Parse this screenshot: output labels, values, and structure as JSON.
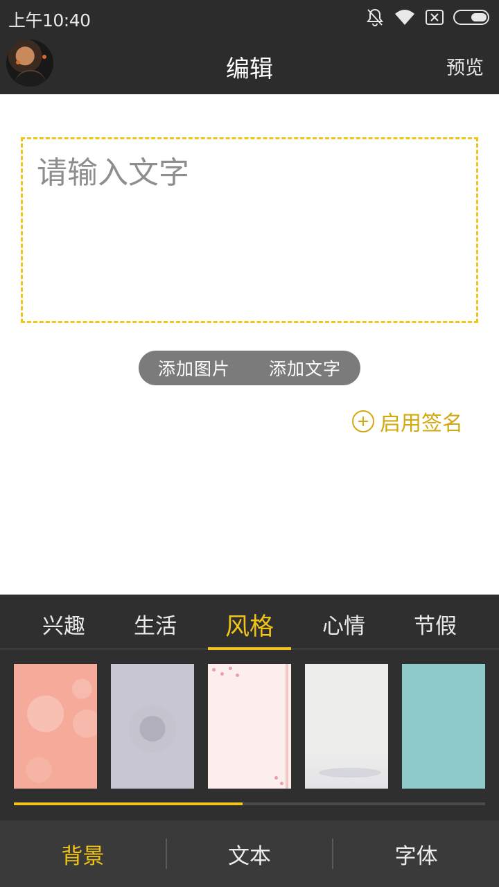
{
  "status_bar": {
    "time": "上午10:40",
    "icons": [
      "notifications-off-icon",
      "wifi-icon",
      "sim-card-none-icon",
      "battery-icon"
    ]
  },
  "header": {
    "title": "编辑",
    "preview_label": "预览",
    "avatar": "user-avatar"
  },
  "editor": {
    "placeholder": "请输入文字",
    "border_color": "#f0c419"
  },
  "add_actions": {
    "add_image": "添加图片",
    "add_text": "添加文字"
  },
  "signature": {
    "label": "启用签名",
    "icon": "plus-circle-icon",
    "color": "#d4a90f"
  },
  "category_tabs": {
    "items": [
      "兴趣",
      "生活",
      "风格",
      "心情",
      "节假"
    ],
    "active_index": 2
  },
  "backgrounds": {
    "thumbnails": [
      "pink-bokeh",
      "lavender-seal",
      "cherry-blossom",
      "misty-landscape",
      "teal-plain"
    ],
    "scroll_progress": 0.485
  },
  "bottom_nav": {
    "items": [
      "背景",
      "文本",
      "字体"
    ],
    "active_index": 0
  },
  "colors": {
    "accent": "#f0c419",
    "dark_bar": "#2c2c2c",
    "panel": "#2f2f2f"
  }
}
